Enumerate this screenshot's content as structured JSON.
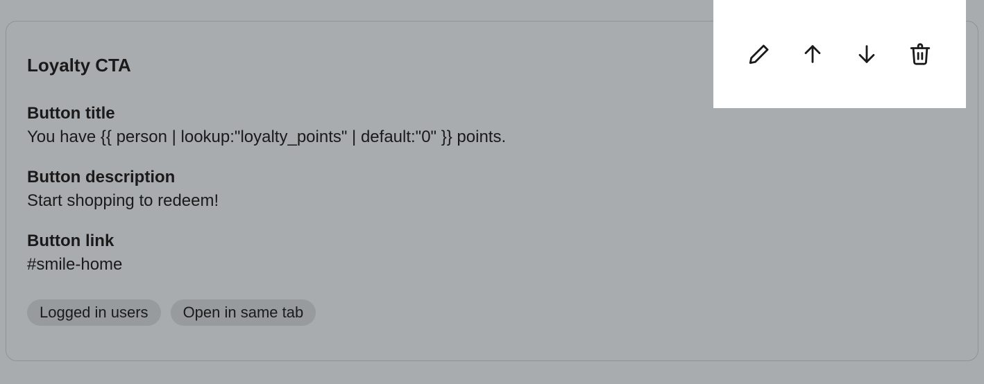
{
  "card": {
    "title": "Loyalty CTA",
    "fields": [
      {
        "label": "Button title",
        "value": "You have {{ person | lookup:\"loyalty_points\" | default:\"0\" }} points."
      },
      {
        "label": "Button description",
        "value": "Start shopping to redeem!"
      },
      {
        "label": "Button link",
        "value": "#smile-home"
      }
    ],
    "tags": [
      "Logged in users",
      "Open in same tab"
    ]
  },
  "toolbar": {
    "actions": [
      "edit",
      "move-up",
      "move-down",
      "delete"
    ]
  }
}
